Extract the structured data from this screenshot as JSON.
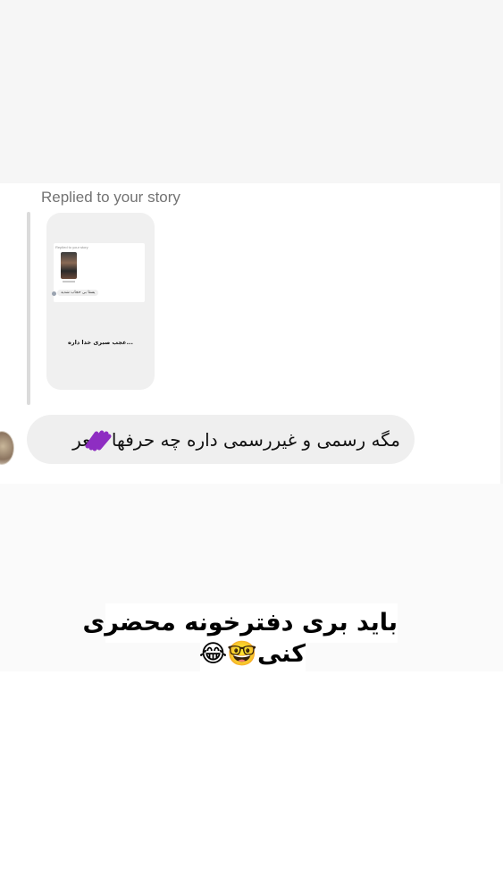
{
  "chat": {
    "replied_label": "Replied to your story",
    "story_preview": {
      "mini_replied_label": "Replied to your story",
      "mini_message": "یستا بی حجاب شدید",
      "caption": "عجب صبری خدا داره..."
    },
    "message": "مگه رسمی و غیررسمی داره چه حرفها  شعر",
    "accent_color": "#8e2dc2"
  },
  "overlay_caption": {
    "line1": "باید بری دفترخونه محضری",
    "line2": "کنی🤓😂"
  }
}
